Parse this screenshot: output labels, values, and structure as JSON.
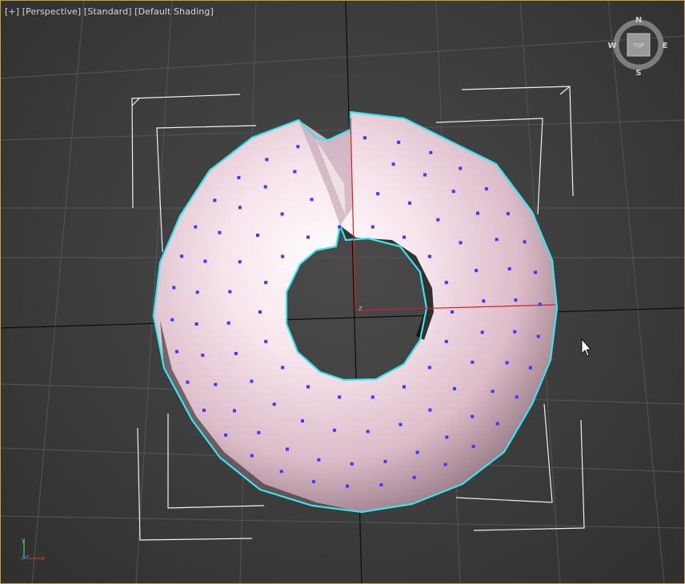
{
  "viewport": {
    "menu_plus": "[+]",
    "view_mode": "[Perspective]",
    "render_mode": "[Standard]",
    "shading_mode": "[Default Shading]"
  },
  "viewcube": {
    "north": "N",
    "south": "S",
    "east": "E",
    "west": "W",
    "face": "TOP"
  },
  "axis_tripod": {
    "x": "x",
    "y": "y",
    "z": "z"
  },
  "gizmo": {
    "axis_label": "z"
  },
  "colors": {
    "grid_line": "#555555",
    "grid_major": "#0d0d0d",
    "selection_outline": "#37e6f0",
    "vertex": "#3c3cff",
    "torus": "#f2d9e3",
    "bbox": "#ffffff",
    "pivot_red": "#d02020",
    "frame": "#c9a13a"
  }
}
